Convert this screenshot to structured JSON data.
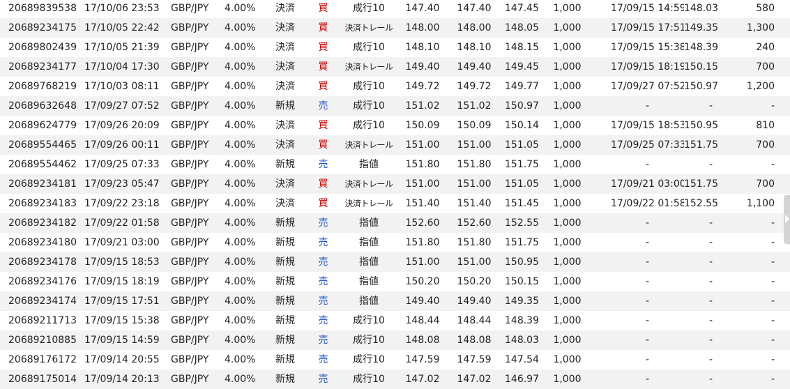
{
  "rows": [
    {
      "id": "20689839538",
      "datetime": "17/10/06 23:53",
      "pair": "GBP/JPY",
      "rate": "4.00%",
      "type": "決済",
      "side": "買",
      "side_kind": "buy",
      "order": "成行10",
      "p1": "147.40",
      "p2": "147.40",
      "p3": "147.45",
      "qty": "1,000",
      "close_dt": "17/09/15 14:59",
      "close_px": "148.03",
      "pl": "580"
    },
    {
      "id": "20689234175",
      "datetime": "17/10/05 22:42",
      "pair": "GBP/JPY",
      "rate": "4.00%",
      "type": "決済",
      "side": "買",
      "side_kind": "buy",
      "order": "決済トレール",
      "p1": "148.00",
      "p2": "148.00",
      "p3": "148.05",
      "qty": "1,000",
      "close_dt": "17/09/15 17:51",
      "close_px": "149.35",
      "pl": "1,300"
    },
    {
      "id": "20689802439",
      "datetime": "17/10/05 21:39",
      "pair": "GBP/JPY",
      "rate": "4.00%",
      "type": "決済",
      "side": "買",
      "side_kind": "buy",
      "order": "成行10",
      "p1": "148.10",
      "p2": "148.10",
      "p3": "148.15",
      "qty": "1,000",
      "close_dt": "17/09/15 15:38",
      "close_px": "148.39",
      "pl": "240"
    },
    {
      "id": "20689234177",
      "datetime": "17/10/04 17:30",
      "pair": "GBP/JPY",
      "rate": "4.00%",
      "type": "決済",
      "side": "買",
      "side_kind": "buy",
      "order": "決済トレール",
      "p1": "149.40",
      "p2": "149.40",
      "p3": "149.45",
      "qty": "1,000",
      "close_dt": "17/09/15 18:19",
      "close_px": "150.15",
      "pl": "700"
    },
    {
      "id": "20689768219",
      "datetime": "17/10/03 08:11",
      "pair": "GBP/JPY",
      "rate": "4.00%",
      "type": "決済",
      "side": "買",
      "side_kind": "buy",
      "order": "成行10",
      "p1": "149.72",
      "p2": "149.72",
      "p3": "149.77",
      "qty": "1,000",
      "close_dt": "17/09/27 07:52",
      "close_px": "150.97",
      "pl": "1,200"
    },
    {
      "id": "20689632648",
      "datetime": "17/09/27 07:52",
      "pair": "GBP/JPY",
      "rate": "4.00%",
      "type": "新規",
      "side": "売",
      "side_kind": "sell",
      "order": "成行10",
      "p1": "151.02",
      "p2": "151.02",
      "p3": "150.97",
      "qty": "1,000",
      "close_dt": "-",
      "close_px": "-",
      "pl": "-"
    },
    {
      "id": "20689624779",
      "datetime": "17/09/26 20:09",
      "pair": "GBP/JPY",
      "rate": "4.00%",
      "type": "決済",
      "side": "買",
      "side_kind": "buy",
      "order": "成行10",
      "p1": "150.09",
      "p2": "150.09",
      "p3": "150.14",
      "qty": "1,000",
      "close_dt": "17/09/15 18:53",
      "close_px": "150.95",
      "pl": "810"
    },
    {
      "id": "20689554465",
      "datetime": "17/09/26 00:11",
      "pair": "GBP/JPY",
      "rate": "4.00%",
      "type": "決済",
      "side": "買",
      "side_kind": "buy",
      "order": "決済トレール",
      "p1": "151.00",
      "p2": "151.00",
      "p3": "151.05",
      "qty": "1,000",
      "close_dt": "17/09/25 07:33",
      "close_px": "151.75",
      "pl": "700"
    },
    {
      "id": "20689554462",
      "datetime": "17/09/25 07:33",
      "pair": "GBP/JPY",
      "rate": "4.00%",
      "type": "新規",
      "side": "売",
      "side_kind": "sell",
      "order": "指値",
      "p1": "151.80",
      "p2": "151.80",
      "p3": "151.75",
      "qty": "1,000",
      "close_dt": "-",
      "close_px": "-",
      "pl": "-"
    },
    {
      "id": "20689234181",
      "datetime": "17/09/23 05:47",
      "pair": "GBP/JPY",
      "rate": "4.00%",
      "type": "決済",
      "side": "買",
      "side_kind": "buy",
      "order": "決済トレール",
      "p1": "151.00",
      "p2": "151.00",
      "p3": "151.05",
      "qty": "1,000",
      "close_dt": "17/09/21 03:00",
      "close_px": "151.75",
      "pl": "700"
    },
    {
      "id": "20689234183",
      "datetime": "17/09/22 23:18",
      "pair": "GBP/JPY",
      "rate": "4.00%",
      "type": "決済",
      "side": "買",
      "side_kind": "buy",
      "order": "決済トレール",
      "p1": "151.40",
      "p2": "151.40",
      "p3": "151.45",
      "qty": "1,000",
      "close_dt": "17/09/22 01:58",
      "close_px": "152.55",
      "pl": "1,100"
    },
    {
      "id": "20689234182",
      "datetime": "17/09/22 01:58",
      "pair": "GBP/JPY",
      "rate": "4.00%",
      "type": "新規",
      "side": "売",
      "side_kind": "sell",
      "order": "指値",
      "p1": "152.60",
      "p2": "152.60",
      "p3": "152.55",
      "qty": "1,000",
      "close_dt": "-",
      "close_px": "-",
      "pl": "-"
    },
    {
      "id": "20689234180",
      "datetime": "17/09/21 03:00",
      "pair": "GBP/JPY",
      "rate": "4.00%",
      "type": "新規",
      "side": "売",
      "side_kind": "sell",
      "order": "指値",
      "p1": "151.80",
      "p2": "151.80",
      "p3": "151.75",
      "qty": "1,000",
      "close_dt": "-",
      "close_px": "-",
      "pl": "-"
    },
    {
      "id": "20689234178",
      "datetime": "17/09/15 18:53",
      "pair": "GBP/JPY",
      "rate": "4.00%",
      "type": "新規",
      "side": "売",
      "side_kind": "sell",
      "order": "指値",
      "p1": "151.00",
      "p2": "151.00",
      "p3": "150.95",
      "qty": "1,000",
      "close_dt": "-",
      "close_px": "-",
      "pl": "-"
    },
    {
      "id": "20689234176",
      "datetime": "17/09/15 18:19",
      "pair": "GBP/JPY",
      "rate": "4.00%",
      "type": "新規",
      "side": "売",
      "side_kind": "sell",
      "order": "指値",
      "p1": "150.20",
      "p2": "150.20",
      "p3": "150.15",
      "qty": "1,000",
      "close_dt": "-",
      "close_px": "-",
      "pl": "-"
    },
    {
      "id": "20689234174",
      "datetime": "17/09/15 17:51",
      "pair": "GBP/JPY",
      "rate": "4.00%",
      "type": "新規",
      "side": "売",
      "side_kind": "sell",
      "order": "指値",
      "p1": "149.40",
      "p2": "149.40",
      "p3": "149.35",
      "qty": "1,000",
      "close_dt": "-",
      "close_px": "-",
      "pl": "-"
    },
    {
      "id": "20689211713",
      "datetime": "17/09/15 15:38",
      "pair": "GBP/JPY",
      "rate": "4.00%",
      "type": "新規",
      "side": "売",
      "side_kind": "sell",
      "order": "成行10",
      "p1": "148.44",
      "p2": "148.44",
      "p3": "148.39",
      "qty": "1,000",
      "close_dt": "-",
      "close_px": "-",
      "pl": "-"
    },
    {
      "id": "20689210885",
      "datetime": "17/09/15 14:59",
      "pair": "GBP/JPY",
      "rate": "4.00%",
      "type": "新規",
      "side": "売",
      "side_kind": "sell",
      "order": "成行10",
      "p1": "148.08",
      "p2": "148.08",
      "p3": "148.03",
      "qty": "1,000",
      "close_dt": "-",
      "close_px": "-",
      "pl": "-"
    },
    {
      "id": "20689176172",
      "datetime": "17/09/14 20:55",
      "pair": "GBP/JPY",
      "rate": "4.00%",
      "type": "新規",
      "side": "売",
      "side_kind": "sell",
      "order": "成行10",
      "p1": "147.59",
      "p2": "147.59",
      "p3": "147.54",
      "qty": "1,000",
      "close_dt": "-",
      "close_px": "-",
      "pl": "-"
    },
    {
      "id": "20689175014",
      "datetime": "17/09/14 20:13",
      "pair": "GBP/JPY",
      "rate": "4.00%",
      "type": "新規",
      "side": "売",
      "side_kind": "sell",
      "order": "成行10",
      "p1": "147.02",
      "p2": "147.02",
      "p3": "146.97",
      "qty": "1,000",
      "close_dt": "-",
      "close_px": "-",
      "pl": "-"
    }
  ],
  "colors": {
    "buy": "#cc0000",
    "sell": "#2255cc",
    "row_alt": "#f2f2f2"
  },
  "icons": {
    "scroll_tab": "chevron-right-icon"
  }
}
